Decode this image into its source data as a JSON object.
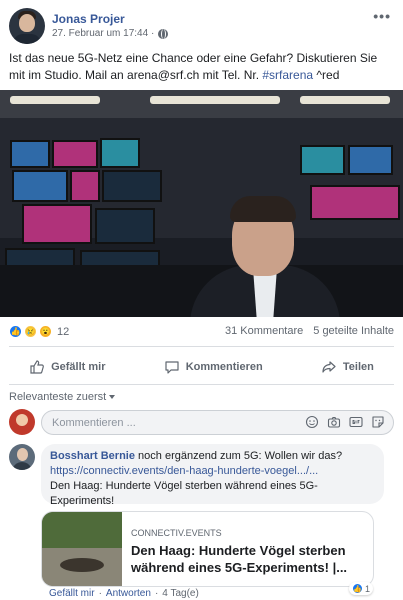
{
  "post": {
    "author": "Jonas Projer",
    "timestamp": "27. Februar um 17:44 ·",
    "privacy_icon": "globe-icon",
    "text_main": "Ist das neue 5G-Netz eine Chance oder eine Gefahr? Diskutieren Sie mit im Studio. Mail an arena@srf.ch mit Tel. Nr. ",
    "hashtag": "#srfarena",
    "text_suffix": " ^red"
  },
  "reactions": {
    "count": "12",
    "types": [
      "like-icon",
      "sad-icon",
      "wow-icon"
    ],
    "comments": "31 Kommentare",
    "shares": "5 geteilte Inhalte"
  },
  "actions": {
    "like": "Gefällt mir",
    "comment": "Kommentieren",
    "share": "Teilen"
  },
  "comments_section": {
    "sort_label": "Relevanteste zuerst",
    "composer_placeholder": "Kommentieren ..."
  },
  "comment": {
    "author": "Bosshart Bernie",
    "text1": " noch ergänzend zum 5G: Wollen wir das?",
    "link": "https://connectiv.events/den-haag-hunderte-voegel.../...",
    "text2": "Den Haag: Hunderte Vögel sterben während eines 5G-Experiments!",
    "card_domain": "CONNECTIV.EVENTS",
    "card_title": "Den Haag: Hunderte Vögel sterben während eines 5G-Experiments! |...",
    "like_action": "Gefällt mir",
    "reply_action": "Antworten",
    "time": "4 Tag(e)",
    "reaction_count": "1"
  },
  "colors": {
    "link": "#385898",
    "secondary_text": "#606770",
    "like_blue": "#1877f2"
  }
}
